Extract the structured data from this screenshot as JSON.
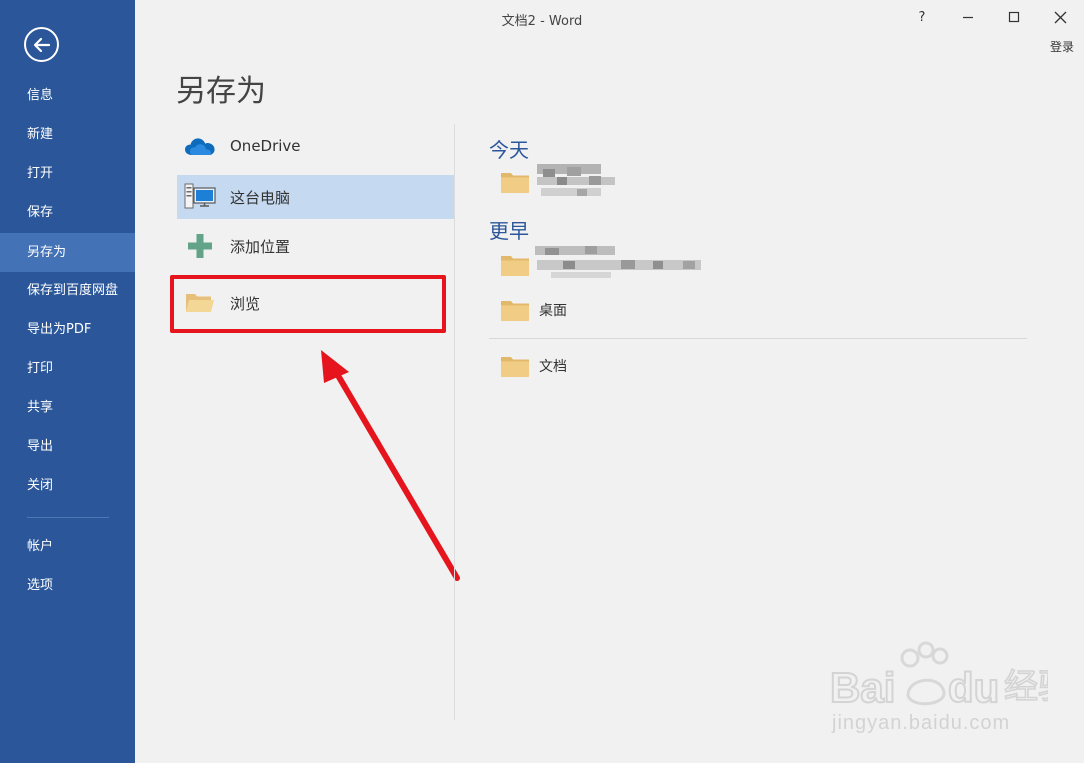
{
  "window": {
    "title": "文档2 - Word",
    "help": "?",
    "signin": "登录"
  },
  "sidebar": {
    "items": [
      {
        "label": "信息",
        "active": false
      },
      {
        "label": "新建",
        "active": false
      },
      {
        "label": "打开",
        "active": false
      },
      {
        "label": "保存",
        "active": false
      },
      {
        "label": "另存为",
        "active": true
      },
      {
        "label": "保存到百度网盘",
        "active": false
      },
      {
        "label": "导出为PDF",
        "active": false
      },
      {
        "label": "打印",
        "active": false
      },
      {
        "label": "共享",
        "active": false
      },
      {
        "label": "导出",
        "active": false
      },
      {
        "label": "关闭",
        "active": false
      }
    ],
    "bottom_items": [
      {
        "label": "帐户"
      },
      {
        "label": "选项"
      }
    ]
  },
  "page": {
    "title": "另存为"
  },
  "locations": [
    {
      "label": "OneDrive",
      "icon": "cloud-icon",
      "selected": false
    },
    {
      "label": "这台电脑",
      "icon": "computer-icon",
      "selected": true
    },
    {
      "label": "添加位置",
      "icon": "plus-icon",
      "selected": false
    },
    {
      "label": "浏览",
      "icon": "open-folder-icon",
      "selected": false
    }
  ],
  "recent": {
    "today_heading": "今天",
    "earlier_heading": "更早",
    "folders": [
      {
        "name": "桌面"
      },
      {
        "name": "文档"
      }
    ]
  },
  "watermark": {
    "text": "jingyan.baidu.com"
  },
  "colors": {
    "sidebar": "#2b579a",
    "active": "#4472b6",
    "selected": "#c5d9f1",
    "highlight": "#e5141d",
    "accent": "#2b579a"
  }
}
